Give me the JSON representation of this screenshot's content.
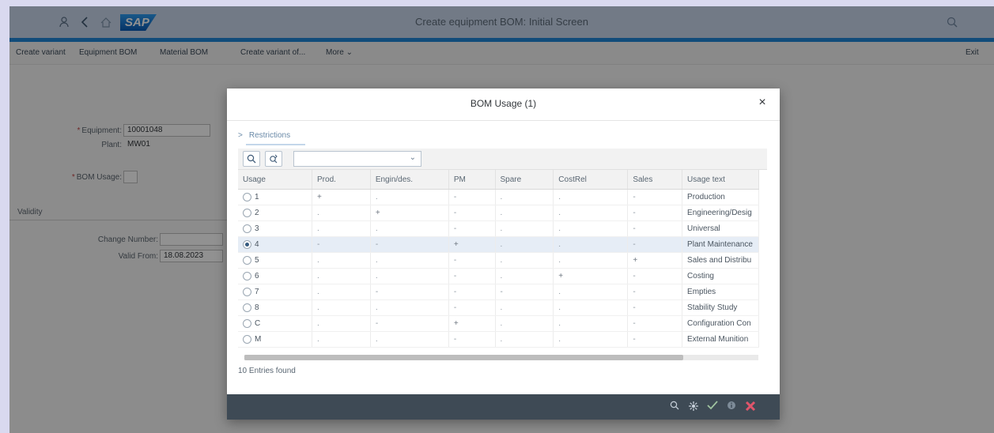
{
  "shell": {
    "title": "Create equipment BOM: Initial Screen",
    "logo": "SAP",
    "icons": [
      "user-icon",
      "back-icon",
      "home-icon",
      "search-icon"
    ]
  },
  "toolbar": {
    "items": [
      "Create variant",
      "Equipment BOM",
      "Material BOM",
      "Create variant of...",
      "More"
    ],
    "exit": "Exit"
  },
  "form": {
    "equipment_label": "Equipment:",
    "equipment_value": "10001048",
    "plant_label": "Plant:",
    "plant_value": "MW01",
    "bom_usage_label": "BOM Usage:",
    "validity_title": "Validity",
    "change_number_label": "Change Number:",
    "valid_from_label": "Valid From:",
    "valid_from_value": "18.08.2023"
  },
  "dialog": {
    "title": "BOM Usage (1)",
    "close": "×",
    "restrictions": "Restrictions",
    "columns": [
      "Usage",
      "Prod.",
      "Engin/des.",
      "PM",
      "Spare",
      "CostRel",
      "Sales",
      "Usage text"
    ],
    "rows": [
      {
        "usage": "1",
        "prod": "+",
        "eng": ".",
        "pm": "-",
        "spare": ".",
        "cost": ".",
        "sales": "-",
        "text": "Production",
        "selected": false
      },
      {
        "usage": "2",
        "prod": ".",
        "eng": "+",
        "pm": "-",
        "spare": ".",
        "cost": ".",
        "sales": "-",
        "text": "Engineering/Desig",
        "selected": false
      },
      {
        "usage": "3",
        "prod": ".",
        "eng": ".",
        "pm": "-",
        "spare": ".",
        "cost": ".",
        "sales": "-",
        "text": "Universal",
        "selected": false
      },
      {
        "usage": "4",
        "prod": "-",
        "eng": "-",
        "pm": "+",
        "spare": ".",
        "cost": ".",
        "sales": "-",
        "text": "Plant Maintenance",
        "selected": true
      },
      {
        "usage": "5",
        "prod": ".",
        "eng": ".",
        "pm": "-",
        "spare": ".",
        "cost": ".",
        "sales": "+",
        "text": "Sales and Distribu",
        "selected": false
      },
      {
        "usage": "6",
        "prod": ".",
        "eng": ".",
        "pm": "-",
        "spare": ".",
        "cost": "+",
        "sales": "-",
        "text": "Costing",
        "selected": false
      },
      {
        "usage": "7",
        "prod": ".",
        "eng": "-",
        "pm": "-",
        "spare": "-",
        "cost": ".",
        "sales": "-",
        "text": "Empties",
        "selected": false
      },
      {
        "usage": "8",
        "prod": ".",
        "eng": ".",
        "pm": "-",
        "spare": ".",
        "cost": ".",
        "sales": "-",
        "text": "Stability Study",
        "selected": false
      },
      {
        "usage": "C",
        "prod": ".",
        "eng": "-",
        "pm": "+",
        "spare": ".",
        "cost": ".",
        "sales": "-",
        "text": "Configuration Con",
        "selected": false
      },
      {
        "usage": "M",
        "prod": ".",
        "eng": ".",
        "pm": "-",
        "spare": ".",
        "cost": ".",
        "sales": "-",
        "text": "External Munition",
        "selected": false
      }
    ],
    "entries_found": "10 Entries found",
    "footer_icons": [
      "search-icon",
      "settings-icon",
      "confirm-icon",
      "info-icon",
      "cancel-icon"
    ]
  }
}
